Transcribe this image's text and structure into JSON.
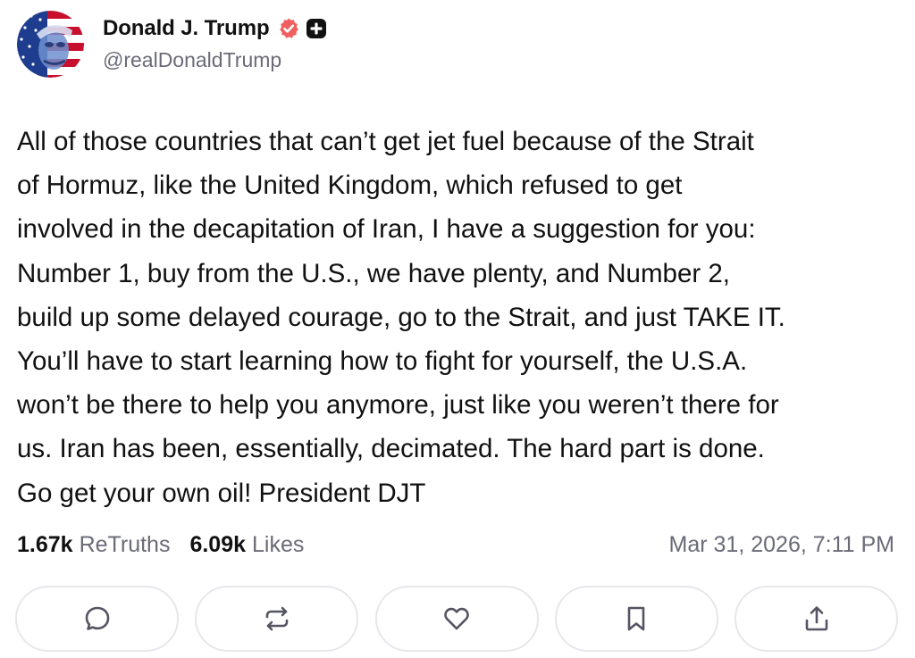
{
  "author": {
    "display_name": "Donald J. Trump",
    "handle": "@realDonaldTrump",
    "verified": true,
    "verified_color": "#f05f5f",
    "badge_icon": "plus-badge-icon"
  },
  "post": {
    "lines": [
      "All of those countries that can’t get jet fuel because of the Strait",
      "of Hormuz, like the United Kingdom, which refused to get",
      "involved in the decapitation of Iran, I have a suggestion for you:",
      "Number 1, buy from the U.S., we have plenty, and Number 2,",
      "build up some delayed courage, go to the Strait, and just TAKE IT.",
      "You’ll have to start learning how to fight for yourself, the U.S.A.",
      "won’t be there to help you anymore, just like you weren’t there for",
      "us. Iran has been, essentially, decimated. The hard part is done.",
      "Go get your own oil! President DJT"
    ]
  },
  "stats": {
    "retruths_count": "1.67k",
    "retruths_label": "ReTruths",
    "likes_count": "6.09k",
    "likes_label": "Likes",
    "timestamp": "Mar 31, 2026, 7:11 PM"
  },
  "actions": [
    {
      "icon": "reply-icon"
    },
    {
      "icon": "retruth-icon"
    },
    {
      "icon": "like-icon"
    },
    {
      "icon": "bookmark-icon"
    },
    {
      "icon": "share-icon"
    }
  ],
  "colors": {
    "text": "#111111",
    "muted": "#6b6b78",
    "border": "#e7e7ec",
    "icon": "#545462"
  }
}
